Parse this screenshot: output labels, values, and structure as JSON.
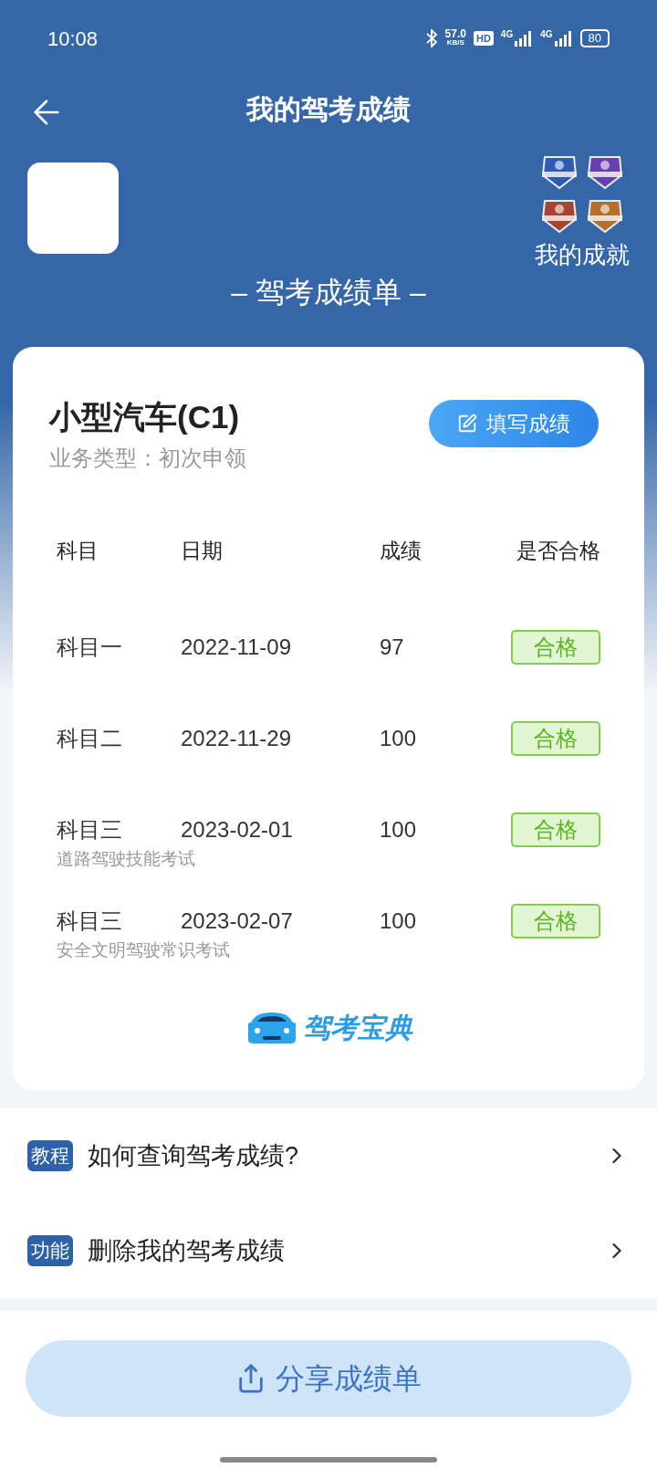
{
  "status_bar": {
    "time": "10:08",
    "speed": "57.0",
    "speed_unit": "KB/S",
    "hd": "HD",
    "networks": [
      "4G",
      "4G"
    ],
    "battery": "80"
  },
  "header": {
    "title": "我的驾考成绩"
  },
  "achievements": {
    "label": "我的成就",
    "badges": [
      {
        "color": "#2f5bb7"
      },
      {
        "color": "#6a3fb0"
      },
      {
        "color": "#a8442f"
      },
      {
        "color": "#b5702a"
      }
    ]
  },
  "section_title": "– 驾考成绩单 –",
  "card": {
    "vehicle": "小型汽车(C1)",
    "business_type": "业务类型：初次申领",
    "fill_button": "填写成绩",
    "columns": [
      "科目",
      "日期",
      "成绩",
      "是否合格"
    ],
    "rows": [
      {
        "subject": "科目一",
        "date": "2022-11-09",
        "score": "97",
        "result": "合格",
        "note": null
      },
      {
        "subject": "科目二",
        "date": "2022-11-29",
        "score": "100",
        "result": "合格",
        "note": null
      },
      {
        "subject": "科目三",
        "date": "2023-02-01",
        "score": "100",
        "result": "合格",
        "note": "道路驾驶技能考试"
      },
      {
        "subject": "科目三",
        "date": "2023-02-07",
        "score": "100",
        "result": "合格",
        "note": "安全文明驾驶常识考试"
      }
    ],
    "logo_text": "驾考宝典"
  },
  "links": [
    {
      "tag": "教程",
      "label": "如何查询驾考成绩?"
    },
    {
      "tag": "功能",
      "label": "删除我的驾考成绩"
    }
  ],
  "share_button": "分享成绩单"
}
